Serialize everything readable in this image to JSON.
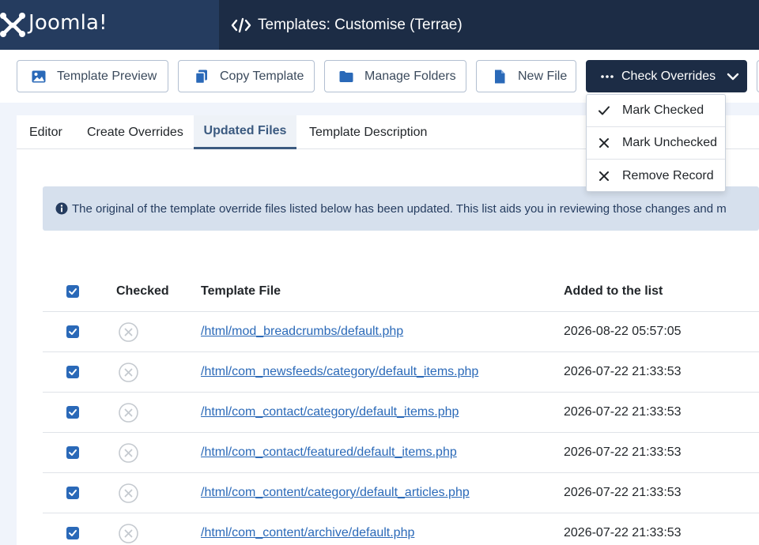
{
  "header": {
    "brand": "Joomla!",
    "title": "Templates: Customise (Terrae)"
  },
  "toolbar": {
    "template_preview": "Template Preview",
    "copy_template": "Copy Template",
    "manage_folders": "Manage Folders",
    "new_file": "New File",
    "check_overrides": "Check Overrides"
  },
  "dropdown": {
    "mark_checked": "Mark Checked",
    "mark_unchecked": "Mark Unchecked",
    "remove_record": "Remove Record"
  },
  "tabs": {
    "editor": "Editor",
    "create_overrides": "Create Overrides",
    "updated_files": "Updated Files",
    "template_description": "Template Description"
  },
  "alert": {
    "text": "The original of the template override files listed below has been updated. This list aids you in reviewing those changes and m"
  },
  "table": {
    "headers": {
      "checked": "Checked",
      "template_file": "Template File",
      "added": "Added to the list"
    },
    "rows": [
      {
        "file": "/html/mod_breadcrumbs/default.php",
        "date": "2026-08-22 05:57:05"
      },
      {
        "file": "/html/com_newsfeeds/category/default_items.php",
        "date": "2026-07-22 21:33:53"
      },
      {
        "file": "/html/com_contact/category/default_items.php",
        "date": "2026-07-22 21:33:53"
      },
      {
        "file": "/html/com_contact/featured/default_items.php",
        "date": "2026-07-22 21:33:53"
      },
      {
        "file": "/html/com_content/category/default_articles.php",
        "date": "2026-07-22 21:33:53"
      },
      {
        "file": "/html/com_content/archive/default.php",
        "date": "2026-07-22 21:33:53"
      }
    ]
  },
  "colors": {
    "header_bg": "#1c2c45",
    "logo_bg": "#253c5f",
    "accent": "#2a69b8",
    "alert_bg": "#d6e0ed"
  }
}
